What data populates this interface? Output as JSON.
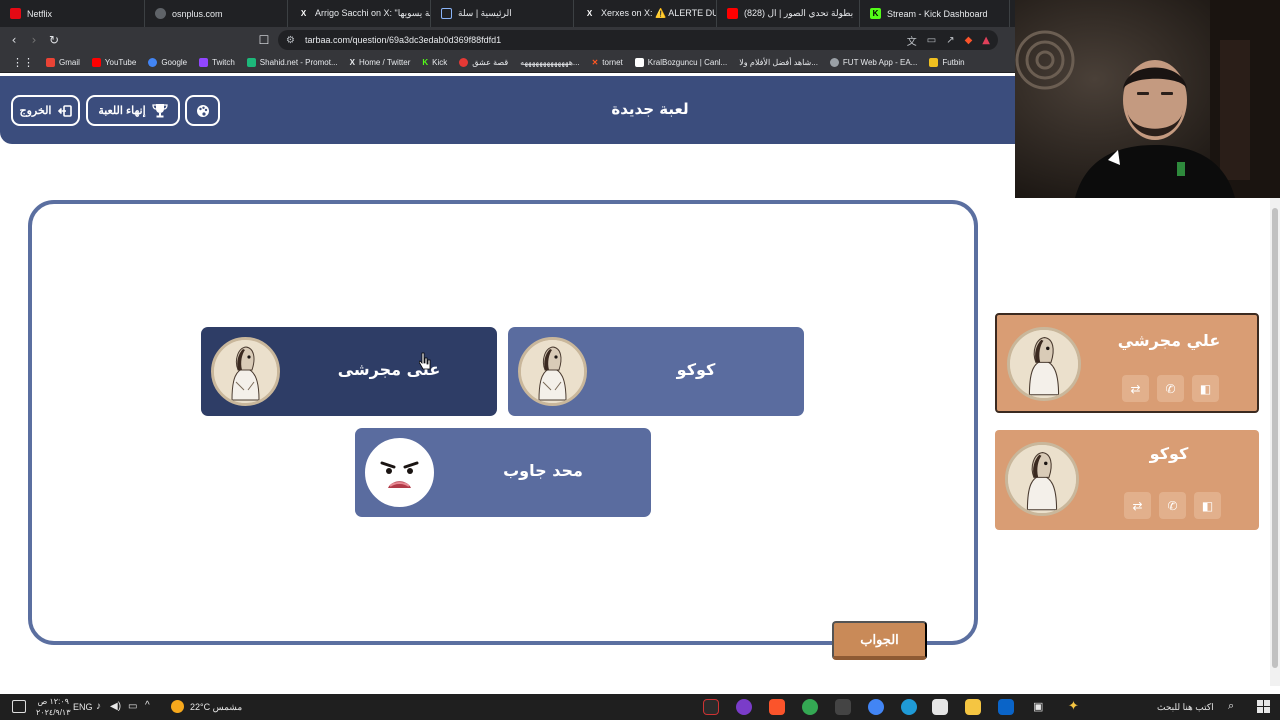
{
  "browser": {
    "tabs": [
      {
        "title": "Netflix",
        "color": "#e50914"
      },
      {
        "title": "osnplus.com",
        "color": "#9aa0a6"
      },
      {
        "title": "Arrigo Sacchi on X: \"لعبة يسويها",
        "color": "#ffffff"
      },
      {
        "title": "",
        "color": "#8ab4f8"
      },
      {
        "title": "الرئيسية | سلة",
        "color": "#5f6368"
      },
      {
        "title": "Xerxes on X: ⚠️ ALERTE DU",
        "color": "#ffffff"
      },
      {
        "title": "(828) بطولة تحدي الصور | ال",
        "color": "#ff0000"
      },
      {
        "title": "Stream - Kick Dashboard",
        "color": "#53fc18"
      }
    ],
    "url": "tarbaa.com/question/69a3dc3edab0d369f88fdfd1",
    "bookmarks": [
      {
        "label": "Gmail",
        "color": "#ea4335"
      },
      {
        "label": "YouTube",
        "color": "#ff0000"
      },
      {
        "label": "Google",
        "color": "#4285f4"
      },
      {
        "label": "Twitch",
        "color": "#9146ff"
      },
      {
        "label": "Shahid.net - Promot...",
        "color": "#1db87a"
      },
      {
        "label": "Home / Twitter",
        "color": "#ffffff"
      },
      {
        "label": "Kick",
        "color": "#53fc18"
      },
      {
        "label": "قصة عشق",
        "color": "#e53935"
      },
      {
        "label": "هههههههههههههه...",
        "color": "#9aa0a6"
      },
      {
        "label": "tornet",
        "color": "#ff5722"
      },
      {
        "label": "KralBozguncu | Canl...",
        "color": "#ffffff"
      },
      {
        "label": "شاهد أفضل الأفلام ولا...",
        "color": "#9aa0a6"
      },
      {
        "label": "FUT Web App - EA...",
        "color": "#9aa0a6"
      },
      {
        "label": "Futbin",
        "color": "#f0c020"
      }
    ]
  },
  "header": {
    "title": "لعبة جديدة",
    "exit_label": "الخروج",
    "end_game_label": "إنهاء اللعبة"
  },
  "board": {
    "players": [
      {
        "name": "على مجرشى",
        "active": true,
        "avatar": "horse-avatar"
      },
      {
        "name": "كوكو",
        "active": false,
        "avatar": "horse-avatar"
      },
      {
        "name": "محد جاوب",
        "active": false,
        "avatar": "sad-face-avatar"
      }
    ],
    "answer_label": "الجواب"
  },
  "teams": [
    {
      "name": "علي مجرشي",
      "active": true
    },
    {
      "name": "كوكو",
      "active": false
    }
  ],
  "taskbar": {
    "search_placeholder": "اكتب هنا للبحث",
    "weather": "22°C مشمس",
    "lang": "ENG",
    "time": "١٢:٠٩ ص",
    "date": "٢٠٢٤/٩/١٣"
  },
  "colors": {
    "header_bg": "#3b4d7d",
    "card_bg": "#5a6c9f",
    "card_active_bg": "#2e3d66",
    "team_bg": "#d99d74",
    "answer_btn": "#c98a58"
  }
}
